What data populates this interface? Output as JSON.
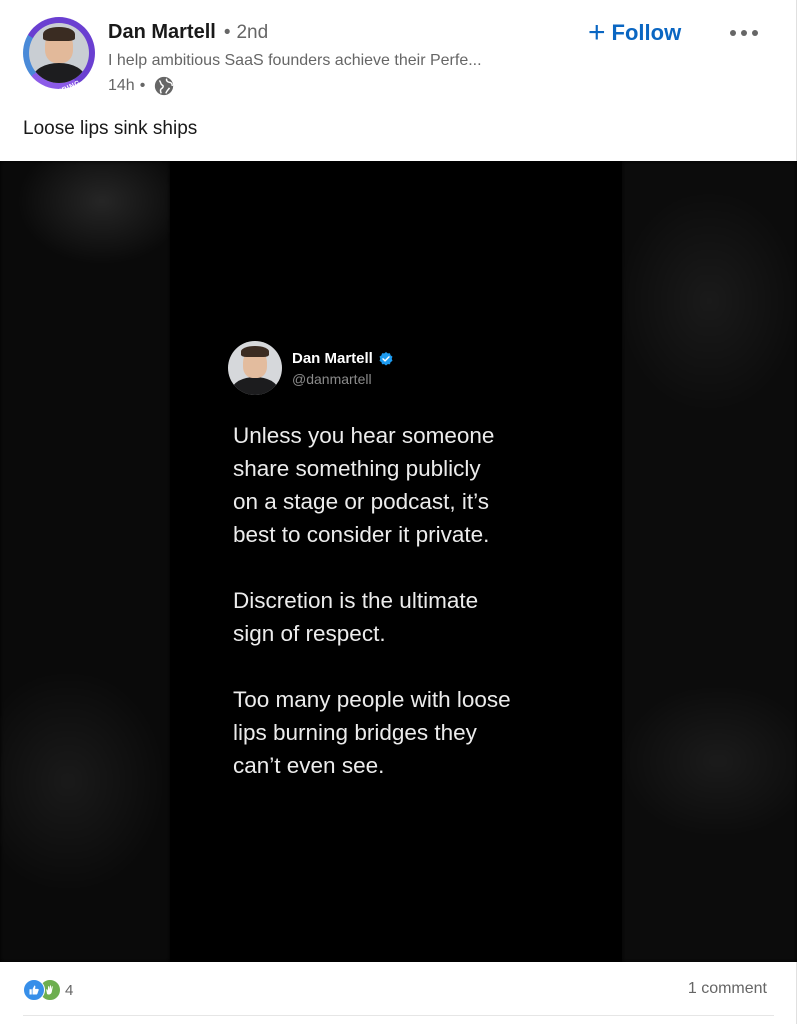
{
  "post": {
    "author": {
      "name": "Dan Martell",
      "degree": "2nd",
      "degree_separator": "•",
      "headline": "I help ambitious SaaS founders achieve their Perfe...",
      "time": "14h",
      "time_separator": "•",
      "visibility_icon": "globe-icon",
      "badge": "HIRING",
      "badge_color": "#6a3fd1"
    },
    "follow_label": "Follow",
    "more_icon": "ellipsis-icon",
    "text": "Loose lips sink ships"
  },
  "media": {
    "background": "#000000",
    "tweet": {
      "name": "Dan Martell",
      "handle": "@danmartell",
      "verified_color": "#1d9bf0",
      "paragraphs": [
        "Unless you hear someone\nshare something publicly\non a stage or podcast, it’s\nbest to consider it private.",
        "Discretion is the ultimate\nsign of respect.",
        "Too many people with loose\nlips burning bridges they\ncan’t even see."
      ]
    }
  },
  "footer": {
    "reactions": [
      "like-icon",
      "celebrate-icon"
    ],
    "reaction_count": "4",
    "comments": "1 comment"
  },
  "colors": {
    "accent": "#0a66c2",
    "muted_text": "#666666",
    "like_blue": "#378fe9",
    "celebrate_green": "#6dae4f"
  }
}
